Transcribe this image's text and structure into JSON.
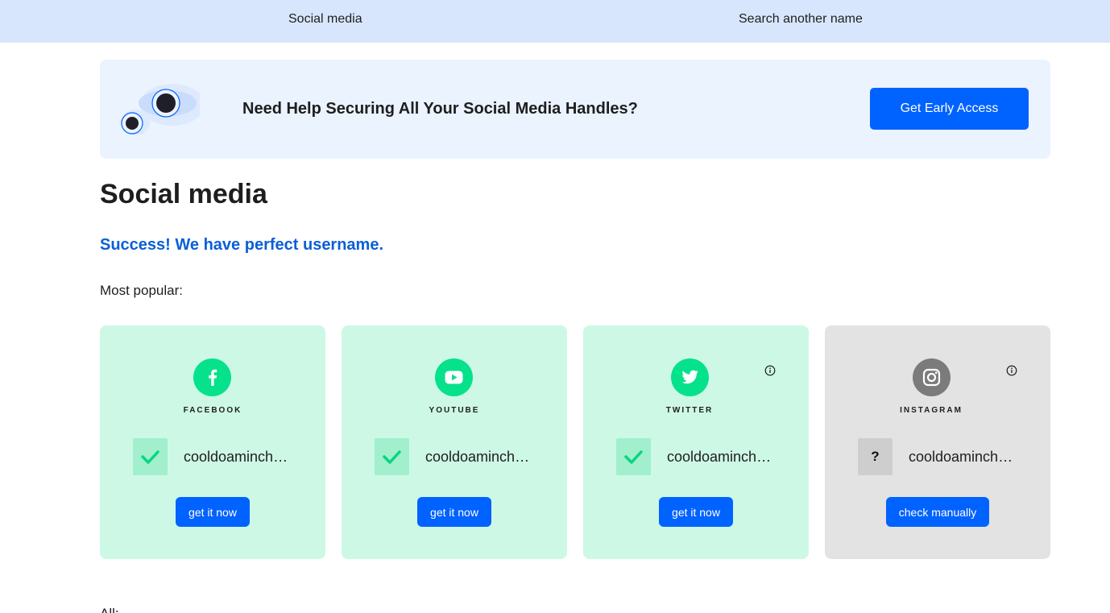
{
  "nav": {
    "items": [
      "Social media",
      "Search another name"
    ]
  },
  "banner": {
    "headline": "Need Help Securing All Your Social Media Handles?",
    "cta_label": "Get Early Access",
    "illustration_icon": "eyes-icon"
  },
  "main": {
    "title": "Social media",
    "success_message": "Success! We have perfect username.",
    "most_popular_label": "Most popular:",
    "all_label": "All:"
  },
  "cards": [
    {
      "platform": "FACEBOOK",
      "icon": "facebook-icon",
      "status": "available",
      "status_icon": "check-icon",
      "username": "cooldoaminchecker",
      "action_label": "get it now"
    },
    {
      "platform": "YOUTUBE",
      "icon": "youtube-icon",
      "status": "available",
      "status_icon": "check-icon",
      "username": "cooldoaminchecker",
      "action_label": "get it now"
    },
    {
      "platform": "TWITTER",
      "icon": "twitter-icon",
      "status": "available",
      "status_icon": "check-icon",
      "username": "cooldoaminchecker",
      "action_label": "get it now",
      "has_info": true
    },
    {
      "platform": "INSTAGRAM",
      "icon": "instagram-icon",
      "status": "unknown",
      "status_symbol": "?",
      "username": "cooldoaminchecker",
      "action_label": "check manually",
      "has_info": true
    }
  ],
  "colors": {
    "nav_bg": "#d8e6fd",
    "banner_bg": "#ebf3ff",
    "primary": "#0062ff",
    "success_text": "#0a5fd6",
    "available_card": "#cdf8e6",
    "available_logo": "#06e18c",
    "unknown_card": "#e3e3e3",
    "unknown_logo": "#7b7b7b"
  }
}
